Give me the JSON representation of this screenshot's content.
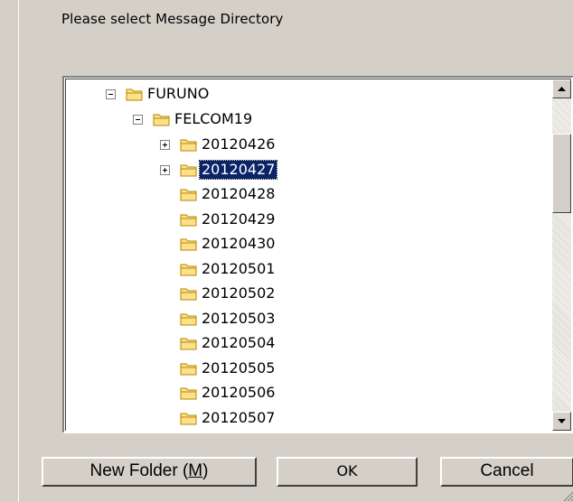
{
  "dialog": {
    "prompt": "Please select  Message Directory"
  },
  "tree": {
    "root": {
      "label": "FURUNO",
      "expander": "minus"
    },
    "child": {
      "label": "FELCOM19",
      "expander": "minus"
    },
    "folders": [
      {
        "label": "20120426",
        "expander": "plus",
        "selected": false
      },
      {
        "label": "20120427",
        "expander": "plus",
        "selected": true
      },
      {
        "label": "20120428",
        "expander": "none",
        "selected": false
      },
      {
        "label": "20120429",
        "expander": "none",
        "selected": false
      },
      {
        "label": "20120430",
        "expander": "none",
        "selected": false
      },
      {
        "label": "20120501",
        "expander": "none",
        "selected": false
      },
      {
        "label": "20120502",
        "expander": "none",
        "selected": false
      },
      {
        "label": "20120503",
        "expander": "none",
        "selected": false
      },
      {
        "label": "20120504",
        "expander": "none",
        "selected": false
      },
      {
        "label": "20120505",
        "expander": "none",
        "selected": false
      },
      {
        "label": "20120506",
        "expander": "none",
        "selected": false
      },
      {
        "label": "20120507",
        "expander": "none",
        "selected": false
      }
    ]
  },
  "buttons": {
    "new_folder_prefix": "New Folder (",
    "new_folder_mnemonic": "M",
    "new_folder_suffix": ")",
    "ok": "OK",
    "cancel": "Cancel"
  },
  "colors": {
    "dialog_bg": "#d4d0c8",
    "selection_bg": "#0a246a",
    "folder_fill": "#ffe08a",
    "folder_stroke": "#b08a00"
  },
  "icons": {
    "folder": "folder-icon",
    "scroll_up": "scroll-up-arrow-icon",
    "scroll_down": "scroll-down-arrow-icon"
  }
}
